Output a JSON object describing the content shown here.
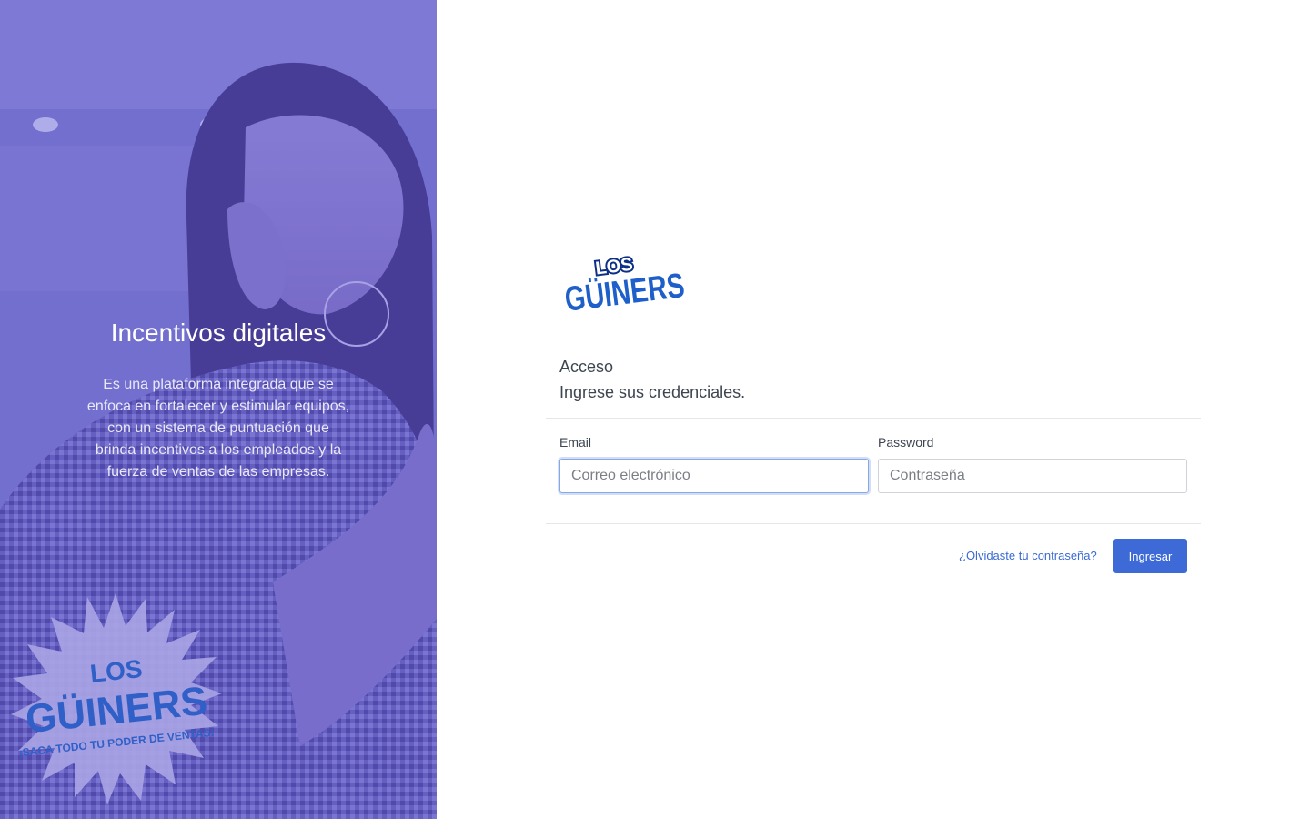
{
  "hero": {
    "title": "Incentivos digitales",
    "description": "Es una plataforma integrada que se enfoca en fortalecer y estimular equipos, con un sistema de puntuación que brinda incentivos a los empleados y la fuerza de ventas de las empresas.",
    "badge": {
      "line1": "LOS",
      "line2": "GÜINERS",
      "tagline": "¡SACA TODO TU PODER DE VENTAS!"
    }
  },
  "brand": {
    "logo_line1": "LOS",
    "logo_line2": "GÜINERS"
  },
  "login": {
    "title": "Acceso",
    "subtitle": "Ingrese sus credenciales.",
    "email": {
      "label": "Email",
      "placeholder": "Correo electrónico",
      "value": ""
    },
    "password": {
      "label": "Password",
      "placeholder": "Contraseña",
      "value": ""
    },
    "forgot_label": "¿Olvidaste tu contraseña?",
    "submit_label": "Ingresar"
  },
  "colors": {
    "hero_overlay": "#7873cc",
    "primary": "#3d6ad6",
    "link": "#3a6bd1",
    "logo_blue": "#1e5fc9",
    "logo_dark": "#0d2f86"
  }
}
